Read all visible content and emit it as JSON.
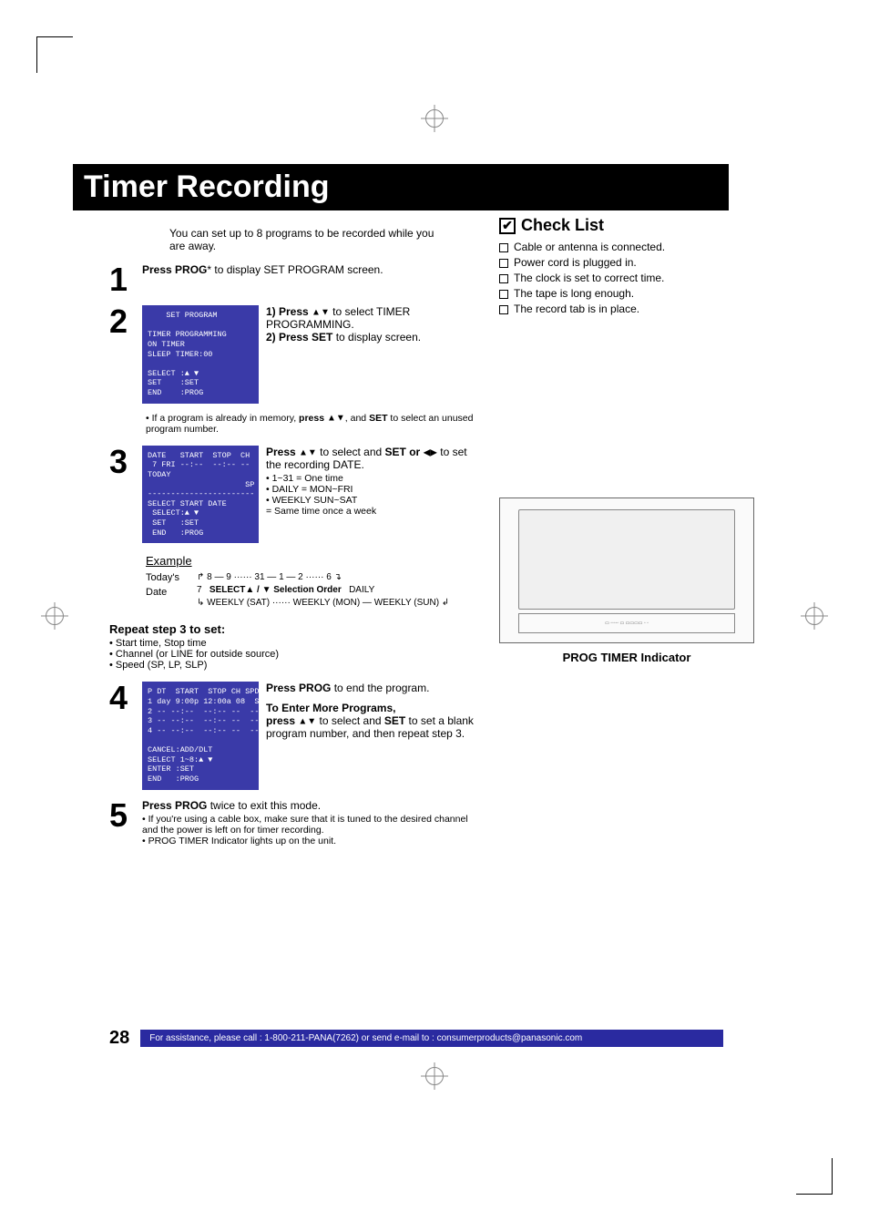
{
  "title": "Timer Recording",
  "intro": "You can set up to 8 programs to be recorded while you are away.",
  "steps": {
    "s1": {
      "n": "1",
      "text_a": "Press PROG",
      "text_b": "* to display SET PROGRAM screen."
    },
    "s2": {
      "n": "2",
      "osd": "    SET PROGRAM\n\nTIMER PROGRAMMING\nON TIMER\nSLEEP TIMER:00\n\nSELECT :▲ ▼\nSET    :SET\nEND    :PROG",
      "instr1_a": "1)  Press ",
      "instr1_b": " to select TIMER PROGRAMMING.",
      "instr2_a": "2)  Press SET",
      "instr2_b": " to display screen.",
      "note_a": "• If a program is already in memory, ",
      "note_b": "press ",
      "note_c": ", and ",
      "note_d": "SET",
      "note_e": " to select an unused  program number."
    },
    "s3": {
      "n": "3",
      "osd": "DATE   START  STOP  CH\n 7 FRI --:--  --:-- --\nTODAY\n                     SP\n-----------------------\nSELECT START DATE\n SELECT:▲ ▼\n SET   :SET\n END   :PROG",
      "instr_a": "Press ",
      "instr_b": " to select and ",
      "instr_c": "SET or ",
      "instr_d": " to set the recording DATE.",
      "b1": "•  1~31 = One time",
      "b2": "•  DAILY = MON~FRI",
      "b3": "•  WEEKLY SUN~SAT",
      "b4": "    = Same time once a week"
    },
    "example": {
      "hdr": "Example",
      "today": "Today's Date",
      "seq": "8 — 9 ······ 31 — 1 — 2 ······ 6",
      "seven": "7",
      "sel": "SELECT▲ / ▼ Selection Order",
      "daily": "DAILY",
      "w1": "WEEKLY (SAT)",
      "w2": "WEEKLY (MON)",
      "w3": "WEEKLY (SUN)"
    },
    "repeat": {
      "hdr": "Repeat step 3 to set:",
      "i1": "Start time, Stop time",
      "i2": "Channel (or LINE for outside source)",
      "i3": "Speed (SP, LP, SLP)"
    },
    "s4": {
      "n": "4",
      "osd": "P DT  START  STOP CH SPD\n1 day 9:00p 12:00a 08  SP\n2 -- --:--  --:-- --  --\n3 -- --:--  --:-- --  --\n4 -- --:--  --:-- --  --\n\nCANCEL:ADD/DLT\nSELECT 1~8:▲ ▼\nENTER :SET\nEND   :PROG",
      "instr_a": "Press PROG",
      "instr_b": " to end the program.",
      "more_hdr": "To Enter More Programs,",
      "more_a": "press ",
      "more_b": " to select and ",
      "more_c": "SET",
      "more_d": " to set a blank program number, and then repeat step 3."
    },
    "s5": {
      "n": "5",
      "a": "Press PROG",
      "b": " twice to exit this mode.",
      "n1": "If you're using a cable box, make sure that it is tuned to the desired channel and the power is left on for timer recording.",
      "n2": "PROG TIMER Indicator lights up on the unit."
    }
  },
  "check": {
    "hdr": "Check List",
    "items": [
      "Cable or antenna is connected.",
      "Power cord is plugged in.",
      "The clock is set to correct time.",
      "The tape is long enough.",
      "The record tab is in place."
    ]
  },
  "vcr_caption": "PROG TIMER Indicator",
  "footer": {
    "page": "28",
    "assist": "For assistance, please call : 1-800-211-PANA(7262) or send e-mail to : consumerproducts@panasonic.com"
  }
}
